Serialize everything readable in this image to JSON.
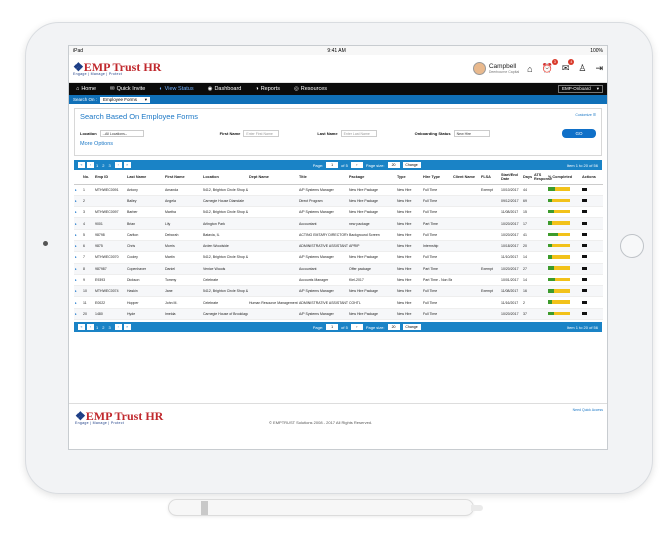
{
  "status_bar": {
    "device": "iPad",
    "time": "9:41 AM",
    "battery": "100%"
  },
  "brand": {
    "name": "EMP Trust HR",
    "tagline": "Engage | Manage | Protect"
  },
  "user": {
    "name": "Campbell",
    "company": "Deerbourne Capital"
  },
  "top_icons": [
    {
      "icon": "home-icon",
      "glyph": "⌂"
    },
    {
      "icon": "alarm-icon",
      "glyph": "⏰",
      "badge": "3"
    },
    {
      "icon": "messages-icon",
      "glyph": "✉",
      "badge": "4"
    },
    {
      "icon": "user-add-icon",
      "glyph": "♙"
    },
    {
      "icon": "logout-icon",
      "glyph": "⇥"
    }
  ],
  "nav": {
    "items": [
      {
        "label": "Home",
        "icon": "⌂",
        "active": false
      },
      {
        "label": "Quick Invite",
        "icon": "✉",
        "active": false
      },
      {
        "label": "View Status",
        "icon": "◐",
        "active": true
      },
      {
        "label": "Dashboard",
        "icon": "◉",
        "active": false
      },
      {
        "label": "Reports",
        "icon": "◑",
        "active": false
      },
      {
        "label": "Resources",
        "icon": "◎",
        "active": false
      }
    ],
    "select": "EMP-Onboard"
  },
  "search_on": {
    "label": "Search On :",
    "value": "Employee Forms"
  },
  "panel": {
    "title": "Search Based On Employee Forms",
    "link": "Customize ☰",
    "location_label": "Location",
    "location_value": "--All Locations--",
    "first_name_label": "First Name",
    "first_name_placeholder": "Enter First Name",
    "last_name_label": "Last Name",
    "last_name_placeholder": "Enter Last Name",
    "onboarding_label": "Onboarding Status",
    "onboarding_value": "New Hire",
    "go": "GO",
    "more": "More Options"
  },
  "pager": {
    "pages": [
      "1",
      "2",
      "3"
    ],
    "page_label": "Page:",
    "page_value": "1",
    "of": "of 5",
    "size_label": "Page size:",
    "size_value": "20",
    "change": "Change",
    "total": "Item 1 to 20 of 56"
  },
  "columns": [
    "",
    "No.",
    "Emp ID",
    "Last Name",
    "First Name",
    "Location",
    "Dept Name",
    "Title",
    "Package",
    "Type",
    "Hire Type",
    "Client Name",
    "FLSA",
    "Start/End Date",
    "Days",
    "ATS Response",
    "% Completed",
    "Actions"
  ],
  "rows": [
    [
      "1",
      "MTHWEC0091",
      "Antony",
      "Amanda",
      "5412, Brighton Circle Shop & Shop",
      "",
      "A/P Systems Manager",
      "New Hire Package",
      "New Hire",
      "Full Time",
      "",
      "Exempt",
      "10/10/2017",
      "44",
      "",
      0.3
    ],
    [
      "2",
      "",
      "Bailey",
      "Angela",
      "Carnegie House Diamdale",
      "",
      "Direct Program",
      "New Hire Package",
      "New Hire",
      "Full Time",
      "",
      "",
      "09/12/2017",
      "69",
      "",
      0.2
    ],
    [
      "3",
      "MTHWEC0097",
      "Barber",
      "Martha",
      "5412, Brighton Circle Shop & Shop",
      "",
      "A/P Systems Manager",
      "New Hire Package",
      "New Hire",
      "Full Time",
      "",
      "",
      "11/08/2017",
      "15",
      "",
      0.25
    ],
    [
      "4",
      "9001",
      "Brian",
      "Lily",
      "Arlington Park",
      "",
      "Accountant",
      "new package",
      "New Hire",
      "Part Time",
      "",
      "",
      "10/20/2017",
      "17",
      "",
      0.2
    ],
    [
      "5",
      "98798",
      "Carlton",
      "Deborah",
      "Batavia, IL",
      "",
      "ACTING EMTARY DIRECTORY",
      "Background Screen",
      "New Hire",
      "Full Time",
      "",
      "",
      "10/20/2017",
      "41",
      "",
      0.45
    ],
    [
      "6",
      "9875",
      "Chris",
      "Morris",
      "Arden Woodside",
      "",
      "ADMINISTRATIVE ASSISTANT",
      "APRIP",
      "New Hire",
      "Internship",
      "",
      "",
      "10/18/2017",
      "20",
      "",
      0.2
    ],
    [
      "7",
      "MTHWEC0070",
      "Cooley",
      "Martin",
      "5412, Brighton Circle Shop & Shop",
      "",
      "A/P Systems Manager",
      "New Hire Package",
      "New Hire",
      "Full Time",
      "",
      "",
      "11/10/2017",
      "14",
      "",
      0.2
    ],
    [
      "8",
      "987987",
      "Copenhaver",
      "Daniel",
      "Venice Woods",
      "",
      "Accountant",
      "Offer package",
      "New Hire",
      "Part Time",
      "",
      "Exempt",
      "10/20/2017",
      "27",
      "",
      0.25
    ],
    [
      "9",
      "E9393",
      "Dickson",
      "Tommy",
      "Celebrate",
      "",
      "Accounts Manager",
      "Kiel-2017",
      "New Hire",
      "Part Time - Non Benefit Eligible",
      "",
      "",
      "10/01/2017",
      "14",
      "",
      0.3
    ],
    [
      "10",
      "MTHWEC0074",
      "Haskin",
      "Jane",
      "5412, Brighton Circle Shop & Shop",
      "",
      "A/P Systems Manager",
      "New Hire Package",
      "New Hire",
      "Full Time",
      "",
      "Exempt",
      "11/08/2017",
      "16",
      "",
      0.25
    ],
    [
      "11",
      "E0022",
      "Hopper",
      "John M.",
      "Celebrate",
      "Human Resource Management",
      "ADMINISTRATIVE ASSISTANT",
      "COHTL",
      "New Hire",
      "Full Time",
      "",
      "",
      "11/16/2017",
      "2",
      "",
      0.2
    ],
    [
      "20",
      "1480",
      "Hyde",
      "Imelda",
      "Carnegie House of Brooklagon",
      "",
      "A/P Systems Manager",
      "New Hire Package",
      "New Hire",
      "Full Time",
      "",
      "",
      "10/20/2017",
      "37",
      "",
      0.25
    ]
  ],
  "footer": {
    "copyright": "© EMPTRUST Solutions 2008 - 2017 All Rights Reserved.",
    "link": "Need Quick Access"
  },
  "colors": {
    "accent": "#1070b8",
    "nav": "#0b0b0b",
    "brand_red": "#c0282d",
    "brand_blue": "#1d3e86",
    "progress_green": "#3d9b2c",
    "progress_yellow": "#f2c21a"
  }
}
